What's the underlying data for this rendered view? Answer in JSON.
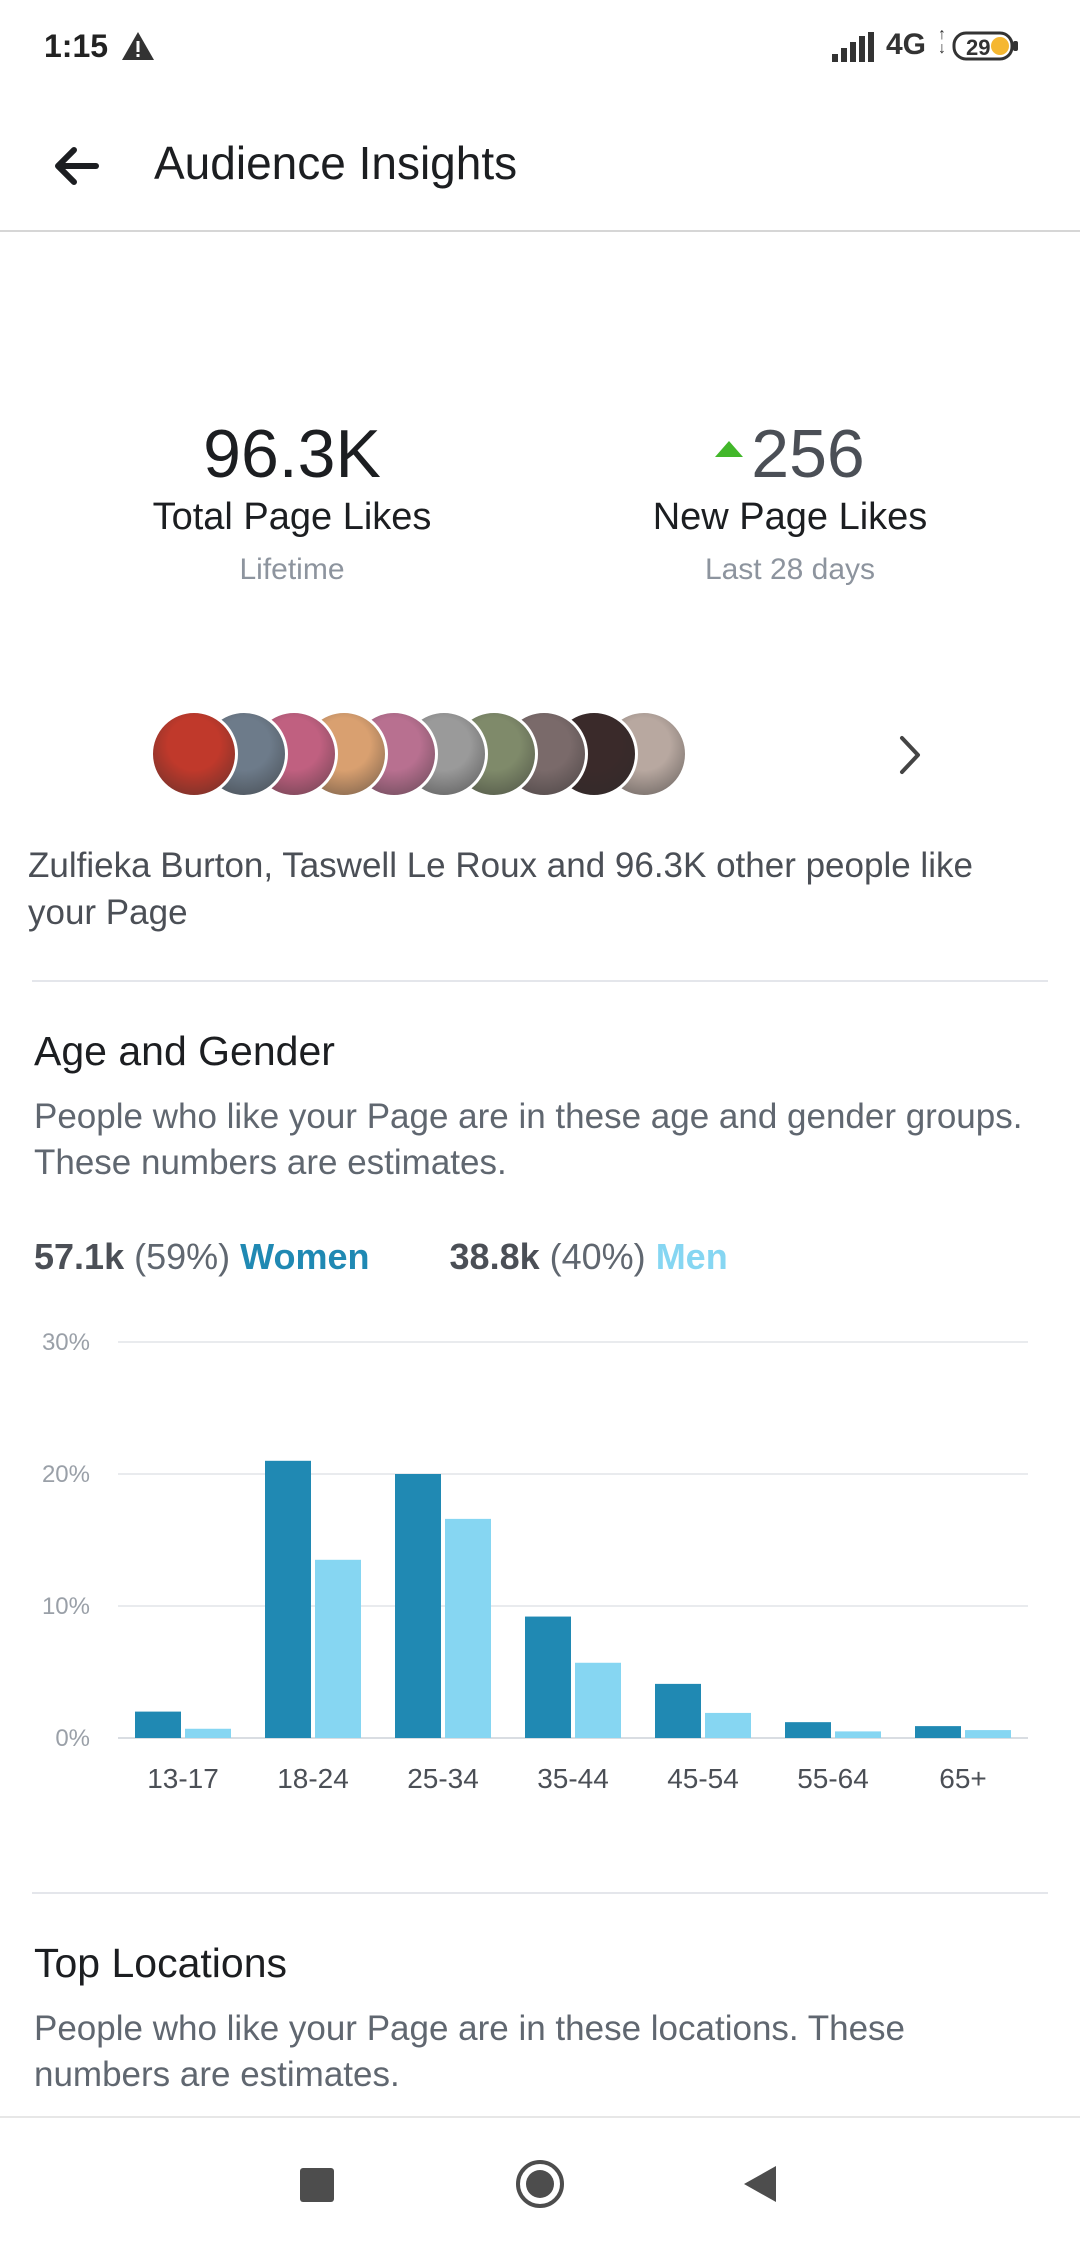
{
  "status_bar": {
    "time": "1:15",
    "network": "4G",
    "battery": "29"
  },
  "header": {
    "title": "Audience Insights"
  },
  "metrics": {
    "total": {
      "value": "96.3K",
      "label": "Total Page Likes",
      "sub": "Lifetime"
    },
    "new": {
      "value": "256",
      "label": "New Page Likes",
      "sub": "Last 28 days",
      "trend": "up"
    }
  },
  "likers": {
    "avatar_colors": [
      "#c0392b",
      "#6d7b8a",
      "#c06080",
      "#d9a070",
      "#b87090",
      "#9a9a9a",
      "#7f8a6a",
      "#7a6a6a",
      "#3a2a2a",
      "#b8a8a0"
    ],
    "text": "Zulfieka Burton, Taswell Le Roux and 96.3K other people like your Page"
  },
  "age_gender": {
    "title": "Age and Gender",
    "description": "People who like your Page are in these age and gender groups. These numbers are estimates.",
    "women": {
      "count": "57.1k",
      "pct": "(59%)",
      "label": "Women",
      "color": "#2089b3"
    },
    "men": {
      "count": "38.8k",
      "pct": "(40%)",
      "label": "Men",
      "color": "#86d6f2"
    }
  },
  "chart_data": {
    "type": "bar",
    "categories": [
      "13-17",
      "18-24",
      "25-34",
      "35-44",
      "45-54",
      "55-64",
      "65+"
    ],
    "series": [
      {
        "name": "Women",
        "values": [
          2,
          21,
          20,
          9.2,
          4.1,
          1.2,
          0.9
        ]
      },
      {
        "name": "Men",
        "values": [
          0.7,
          13.5,
          16.6,
          5.7,
          1.9,
          0.5,
          0.6
        ]
      }
    ],
    "yticks": [
      "0%",
      "10%",
      "20%",
      "30%"
    ],
    "ylim": [
      0,
      30
    ],
    "grid": true
  },
  "top_locations": {
    "title": "Top Locations",
    "description": "People who like your Page are in these locations. These numbers are estimates."
  }
}
